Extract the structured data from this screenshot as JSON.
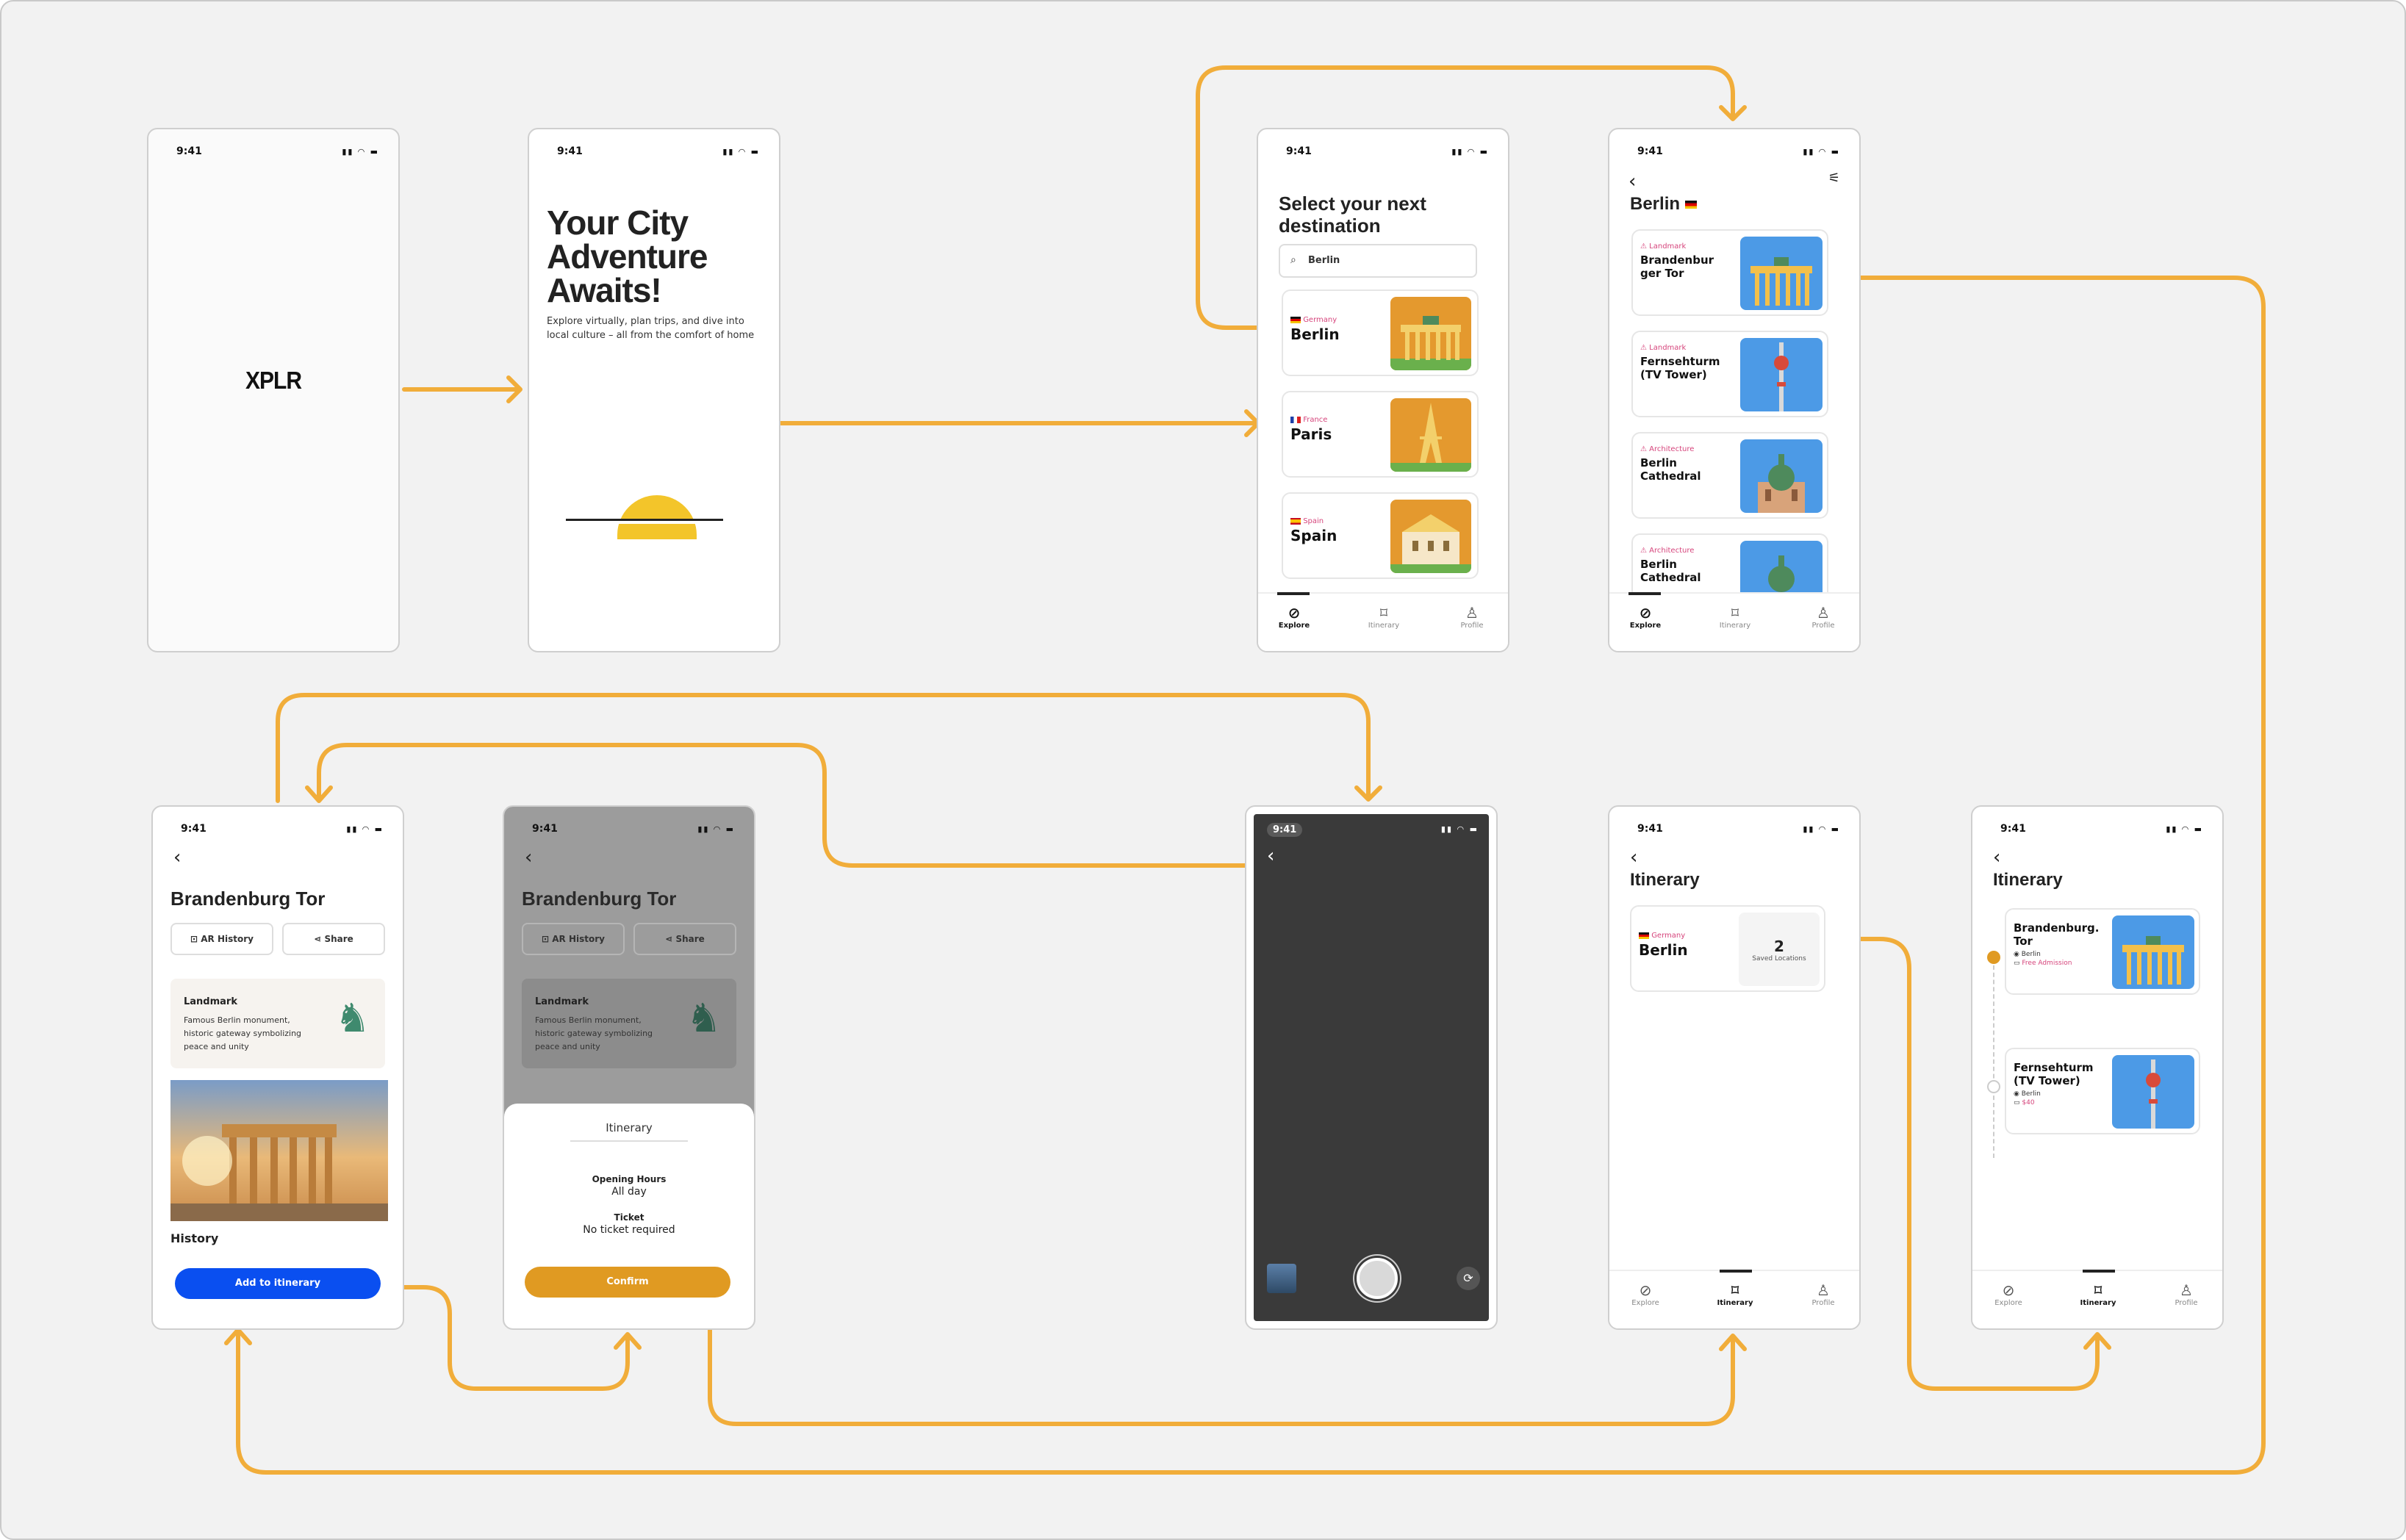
{
  "colors": {
    "arrow": "#f1ad3a",
    "accent_pink": "#d6457c",
    "primary_blue": "#0a4ff0",
    "confirm_orange": "#e09a22",
    "thumb_orange": "#e4992e",
    "thumb_blue": "#4c9ae6",
    "camera_bg": "#3a3a3a"
  },
  "status_time": "9:41",
  "splash": {
    "logo": "XPLR"
  },
  "onboarding": {
    "title_line1": "Your City",
    "title_line2": "Adventure",
    "title_line3": "Awaits!",
    "subtitle": "Explore virtually, plan trips, and dive into local culture – all from the comfort of home"
  },
  "nav": {
    "explore": "Explore",
    "itinerary": "Itinerary",
    "profile": "Profile"
  },
  "select_destination": {
    "title_line1": "Select your next",
    "title_line2": "destination",
    "search_value": "Berlin",
    "cards": [
      {
        "country": "Germany",
        "city": "Berlin",
        "flag": "de"
      },
      {
        "country": "France",
        "city": "Paris",
        "flag": "fr"
      },
      {
        "country": "Spain",
        "city": "Spain",
        "flag": "es"
      }
    ]
  },
  "berlin_list": {
    "title": "Berlin",
    "items": [
      {
        "tag": "Landmark",
        "name_line1": "Brandenbur",
        "name_line2": "ger Tor"
      },
      {
        "tag": "Landmark",
        "name_line1": "Fernsehturm",
        "name_line2": "(TV Tower)"
      },
      {
        "tag": "Architecture",
        "name_line1": "Berlin",
        "name_line2": "Cathedral"
      },
      {
        "tag": "Architecture",
        "name_line1": "Berlin",
        "name_line2": "Cathedral"
      }
    ]
  },
  "detail": {
    "title": "Brandenburg Tor",
    "ar_button": "AR History",
    "share_button": "Share",
    "info_tag": "Landmark",
    "info_line1": "Famous Berlin monument,",
    "info_line2": "historic gateway symbolizing",
    "info_line3": "peace and unity",
    "history_label": "History",
    "add_button": "Add to itinerary"
  },
  "sheet": {
    "title": "Itinerary",
    "hours_label": "Opening Hours",
    "hours_value": "All day",
    "ticket_label": "Ticket",
    "ticket_value": "No ticket required",
    "confirm": "Confirm"
  },
  "itinerary_summary": {
    "title": "Itinerary",
    "country": "Germany",
    "city": "Berlin",
    "count": "2",
    "count_label": "Saved Locations"
  },
  "itinerary_detail": {
    "title": "Itinerary",
    "items": [
      {
        "name_line1": "Brandenburg.",
        "name_line2": "Tor",
        "location": "Berlin",
        "extra": "Free Admission"
      },
      {
        "name_line1": "Fernsehturm",
        "name_line2": "(TV Tower)",
        "location": "Berlin",
        "extra": "$40"
      }
    ]
  }
}
